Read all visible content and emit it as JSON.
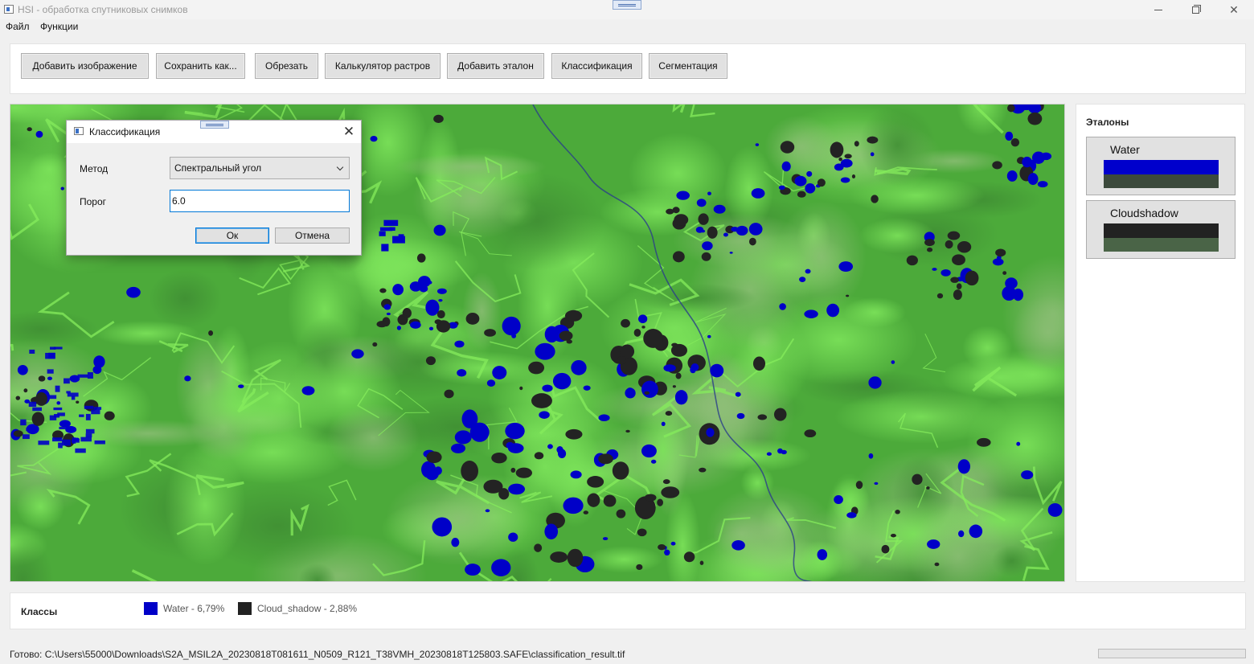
{
  "window": {
    "title": "HSI - обработка спутниковых снимков",
    "minimize_glyph": "—",
    "maximize_glyph": "❐",
    "close_glyph": "✕"
  },
  "menu": {
    "file": "Файл",
    "functions": "Функции"
  },
  "toolbar": {
    "buttons": [
      {
        "label": "Добавить изображение"
      },
      {
        "label": "Сохранить как..."
      },
      {
        "label": "Обрезать"
      },
      {
        "label": "Калькулятор растров"
      },
      {
        "label": "Добавить эталон"
      },
      {
        "label": "Классификация"
      },
      {
        "label": "Сегментация"
      }
    ]
  },
  "right_panel": {
    "title": "Эталоны",
    "etalons": [
      {
        "name": "Water",
        "color_top": "#0000cc",
        "color_bottom": "#3c4a3c"
      },
      {
        "name": "Cloudshadow",
        "color_top": "#222222",
        "color_bottom": "#4a6447"
      }
    ]
  },
  "classes": {
    "label": "Классы",
    "items": [
      {
        "text": "Water - 6,79%",
        "color": "#0000c8"
      },
      {
        "text": "Cloud_shadow - 2,88%",
        "color": "#222222"
      }
    ]
  },
  "status": {
    "text": "Готово: C:\\Users\\55000\\Downloads\\S2A_MSIL2A_20230818T081611_N0509_R121_T38VMH_20230818T125803.SAFE\\classification_result.tif",
    "progress": 0
  },
  "dialog": {
    "title": "Классификация",
    "close_glyph": "✕",
    "method_label": "Метод",
    "method_value": "Спектральный угол",
    "threshold_label": "Порог",
    "threshold_value": "6.0",
    "ok_label": "Ок",
    "cancel_label": "Отмена"
  },
  "map": {
    "base_color": "#4caa3a",
    "water_color": "#0000c8",
    "shadow_color": "#232323"
  }
}
